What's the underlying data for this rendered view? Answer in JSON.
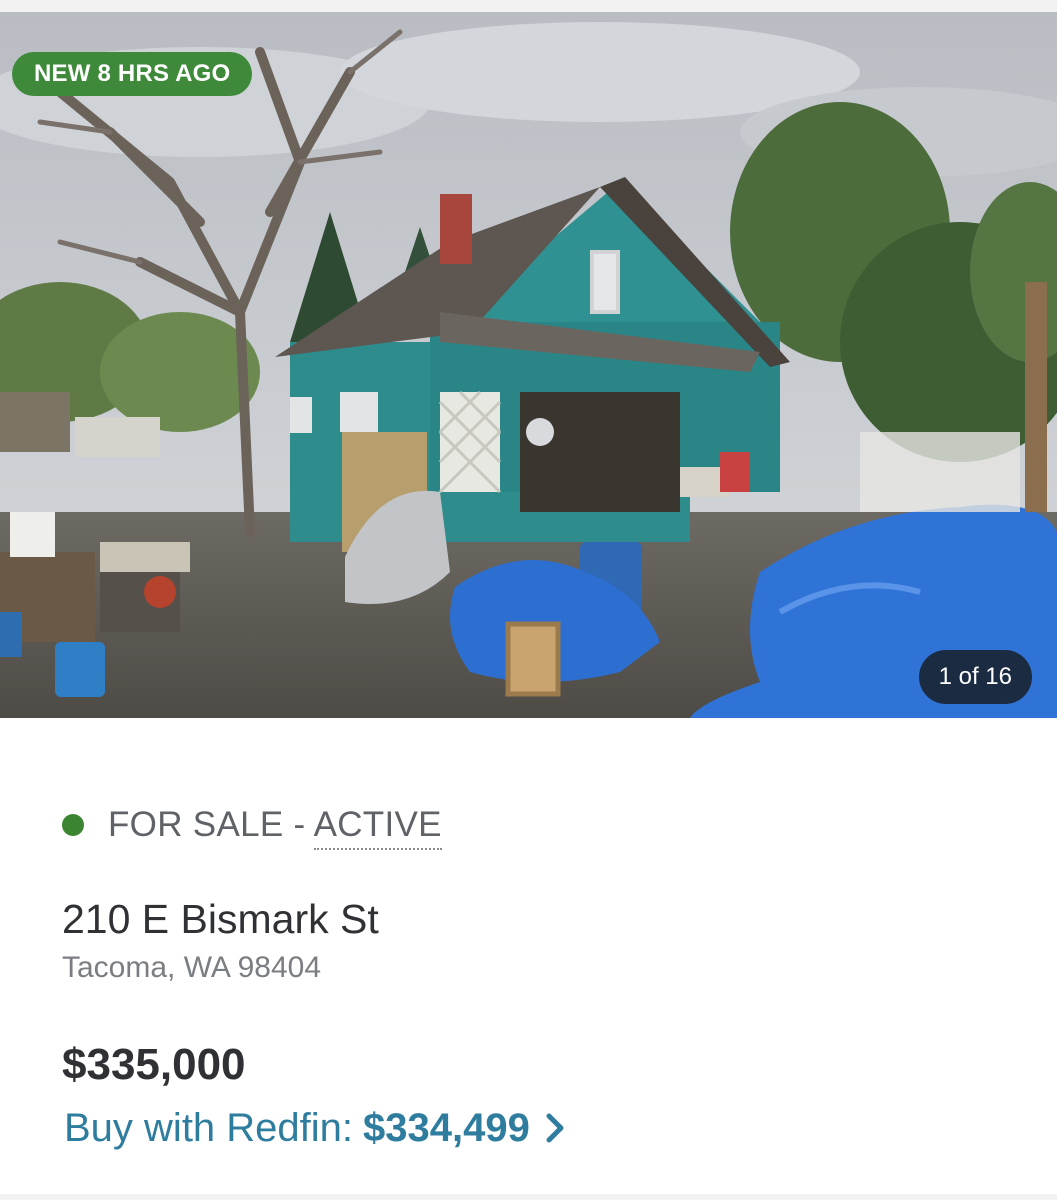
{
  "photo": {
    "badge": "NEW 8 HRS AGO",
    "counter": "1 of 16",
    "badge_color": "#3e8a3a"
  },
  "listing": {
    "status_prefix": "FOR SALE - ",
    "status_active": "ACTIVE",
    "status_color": "#3b8532",
    "street": "210 E Bismark St",
    "city_state_zip": "Tacoma, WA 98404",
    "price": "$335,000",
    "buy_label": "Buy with Redfin:",
    "buy_price": "$334,499",
    "link_color": "#2f7d9e"
  },
  "icons": {
    "status": "status-dot-icon",
    "more": "chevron-right-icon"
  }
}
